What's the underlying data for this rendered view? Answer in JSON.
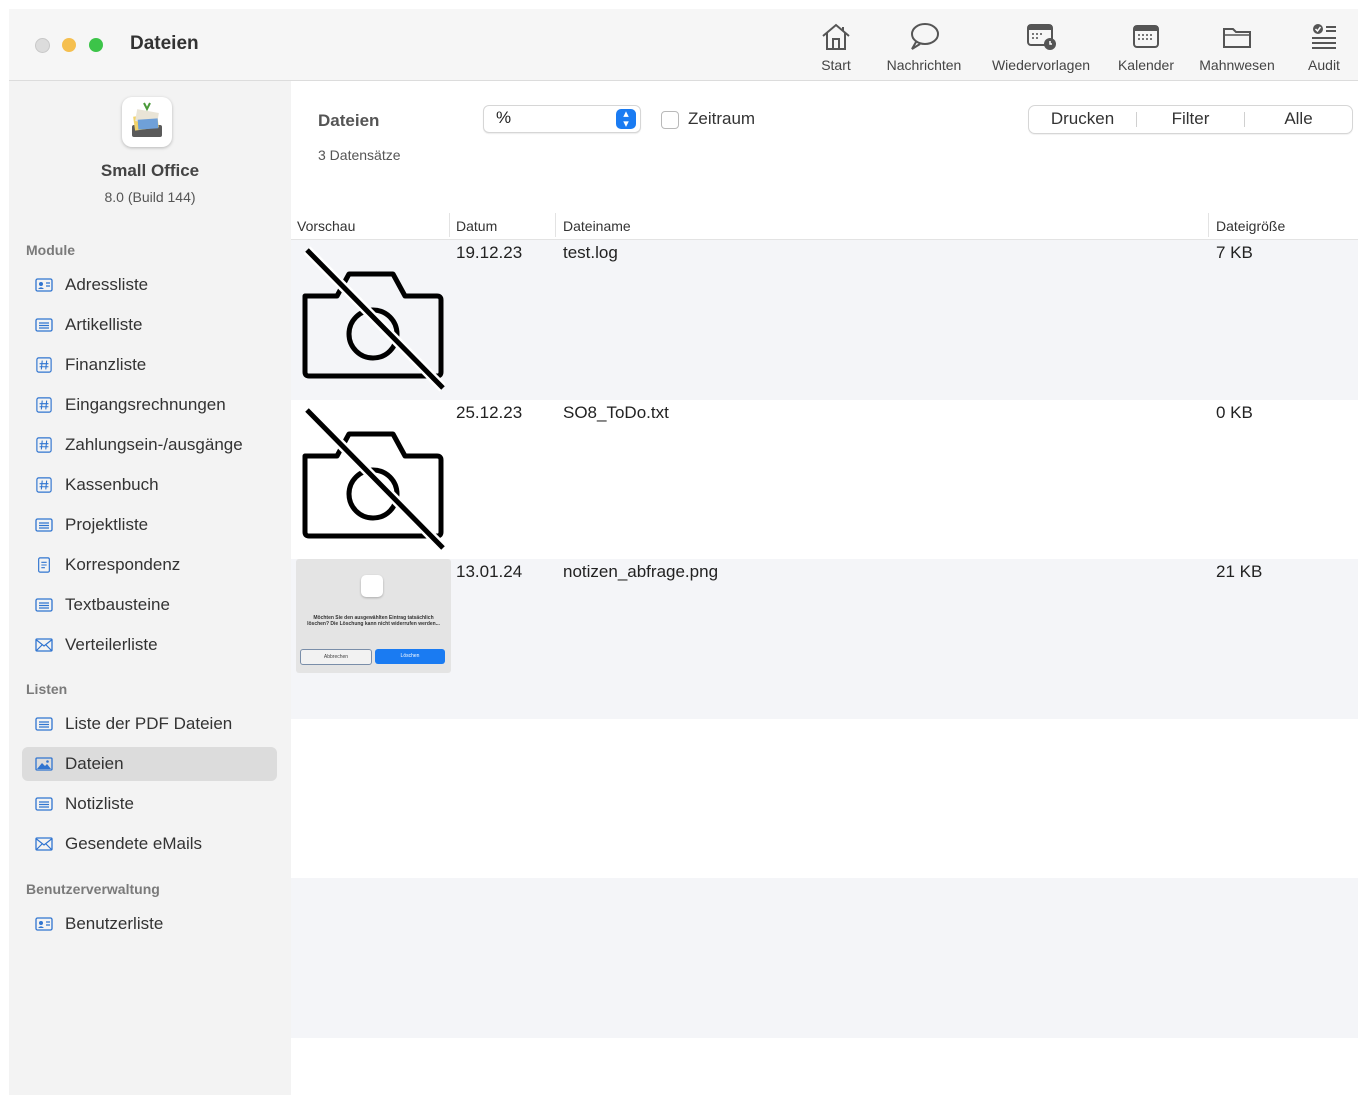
{
  "window": {
    "title": "Dateien"
  },
  "toolbar": {
    "start": "Start",
    "nachrichten": "Nachrichten",
    "wiedervorlagen": "Wiedervorlagen",
    "kalender": "Kalender",
    "mahnwesen": "Mahnwesen",
    "audit": "Audit"
  },
  "app": {
    "name": "Small Office",
    "version": "8.0 (Build 144)"
  },
  "sidebar": {
    "sections": [
      {
        "title": "Module",
        "items": [
          {
            "label": "Adressliste",
            "icon": "address-card-icon"
          },
          {
            "label": "Artikelliste",
            "icon": "list-icon"
          },
          {
            "label": "Finanzliste",
            "icon": "hash-icon"
          },
          {
            "label": "Eingangsrechnungen",
            "icon": "hash-icon"
          },
          {
            "label": "Zahlungsein-/ausgänge",
            "icon": "hash-icon"
          },
          {
            "label": "Kassenbuch",
            "icon": "hash-icon"
          },
          {
            "label": "Projektliste",
            "icon": "list-icon"
          },
          {
            "label": "Korrespondenz",
            "icon": "document-icon"
          },
          {
            "label": "Textbausteine",
            "icon": "list-icon"
          },
          {
            "label": "Verteilerliste",
            "icon": "envelope-icon"
          }
        ]
      },
      {
        "title": "Listen",
        "items": [
          {
            "label": "Liste der PDF Dateien",
            "icon": "list-icon"
          },
          {
            "label": "Dateien",
            "icon": "image-icon",
            "active": true
          },
          {
            "label": "Notizliste",
            "icon": "list-icon"
          },
          {
            "label": "Gesendete eMails",
            "icon": "envelope-icon"
          }
        ]
      },
      {
        "title": "Benutzerverwaltung",
        "items": [
          {
            "label": "Benutzerliste",
            "icon": "address-card-icon"
          }
        ]
      }
    ]
  },
  "main": {
    "title": "Dateien",
    "count": "3 Datensätze",
    "select_value": "%",
    "zeitraum_label": "Zeitraum",
    "zeitraum_checked": false,
    "buttons": {
      "drucken": "Drucken",
      "filter": "Filter",
      "alle": "Alle"
    }
  },
  "table": {
    "columns": {
      "vorschau": "Vorschau",
      "datum": "Datum",
      "dateiname": "Dateiname",
      "groesse": "Dateigröße"
    },
    "rows": [
      {
        "datum": "19.12.23",
        "dateiname": "test.log",
        "groesse": "7 KB",
        "preview": "no-preview-icon"
      },
      {
        "datum": "25.12.23",
        "dateiname": "SO8_ToDo.txt",
        "groesse": "0 KB",
        "preview": "no-preview-icon"
      },
      {
        "datum": "13.01.24",
        "dateiname": "notizen_abfrage.png",
        "groesse": "21 KB",
        "preview": "screenshot-thumbnail"
      }
    ],
    "thumbnail": {
      "message": "Möchten Sie den ausgewählten Eintrag tatsächlich löschen? Die Löschung kann nicht widerrufen werden...",
      "cancel": "Abbrechen",
      "delete": "Löschen"
    }
  }
}
